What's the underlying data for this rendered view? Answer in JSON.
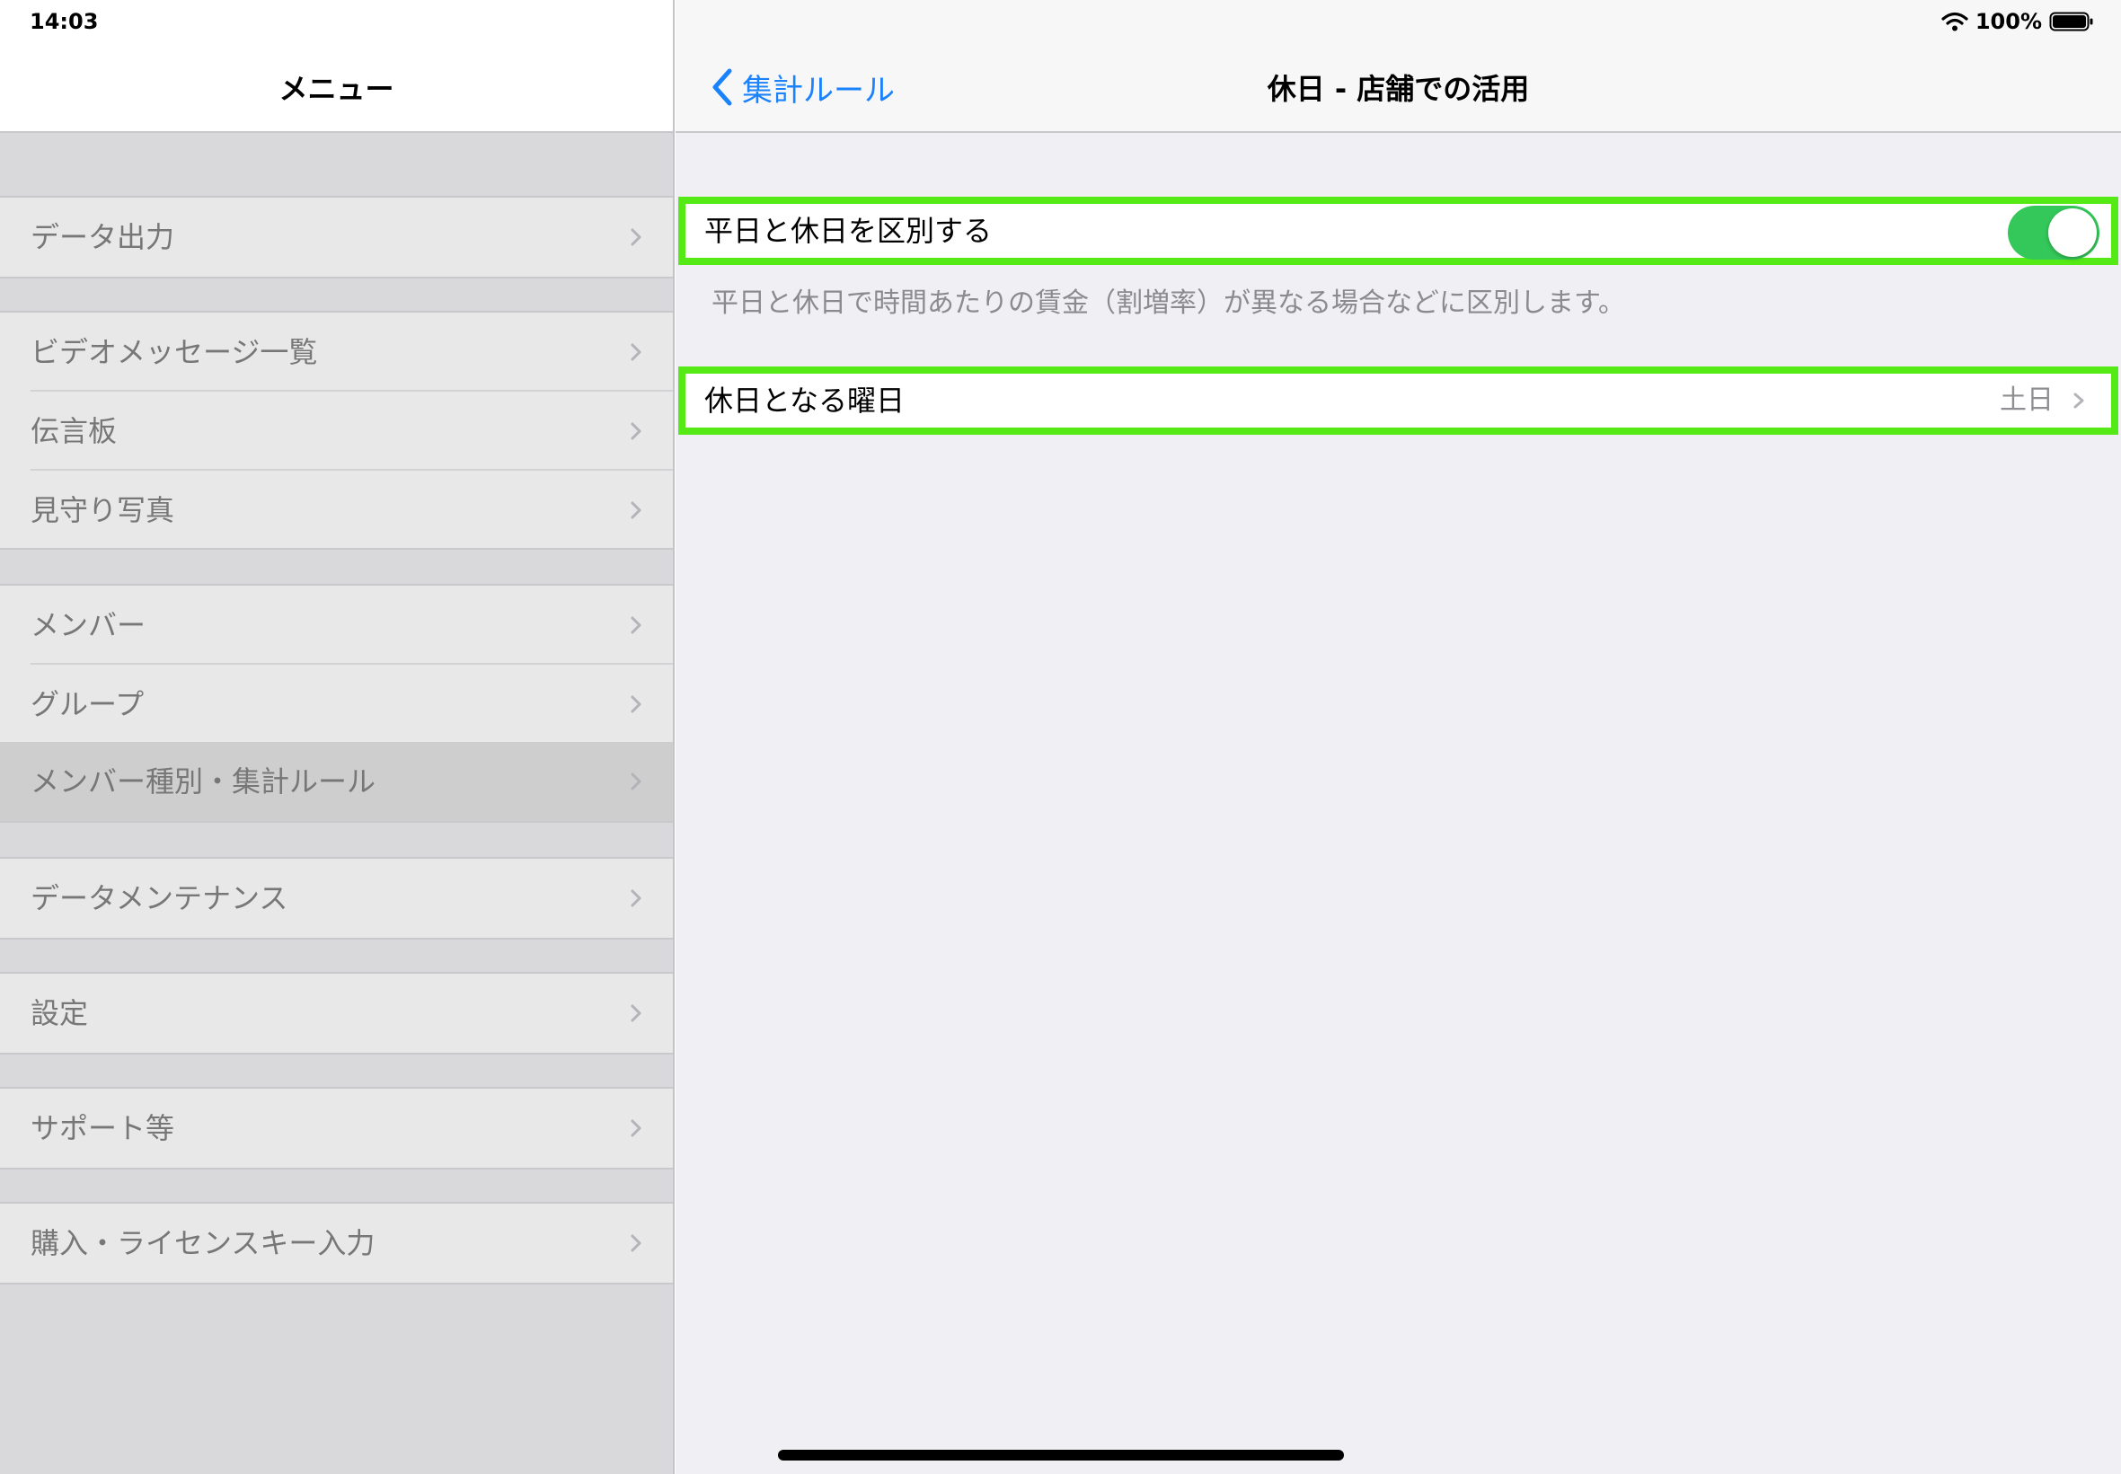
{
  "status_bar": {
    "time": "14:03",
    "battery": "100%"
  },
  "menu": {
    "title": "メニュー",
    "items": [
      {
        "label": "データ出力"
      },
      {
        "label": "ビデオメッセージ一覧"
      },
      {
        "label": "伝言板"
      },
      {
        "label": "見守り写真"
      },
      {
        "label": "メンバー"
      },
      {
        "label": "グループ"
      },
      {
        "label": "メンバー種別・集計ルール",
        "selected": true
      },
      {
        "label": "データメンテナンス"
      },
      {
        "label": "設定"
      },
      {
        "label": "サポート等"
      },
      {
        "label": "購入・ライセンスキー入力"
      }
    ]
  },
  "detail": {
    "back_label": "集計ルール",
    "title": "休日 - 店舗での活用",
    "distinguish": {
      "label": "平日と休日を区別する",
      "enabled": true,
      "footer": "平日と休日で時間あたりの賃金（割増率）が異なる場合などに区別します。"
    },
    "holiday_weekday": {
      "label": "休日となる曜日",
      "value": "土日"
    }
  },
  "colors": {
    "accent": "#1a82fb",
    "toggle_on": "#34c759",
    "highlight_frame": "#55ea16"
  }
}
